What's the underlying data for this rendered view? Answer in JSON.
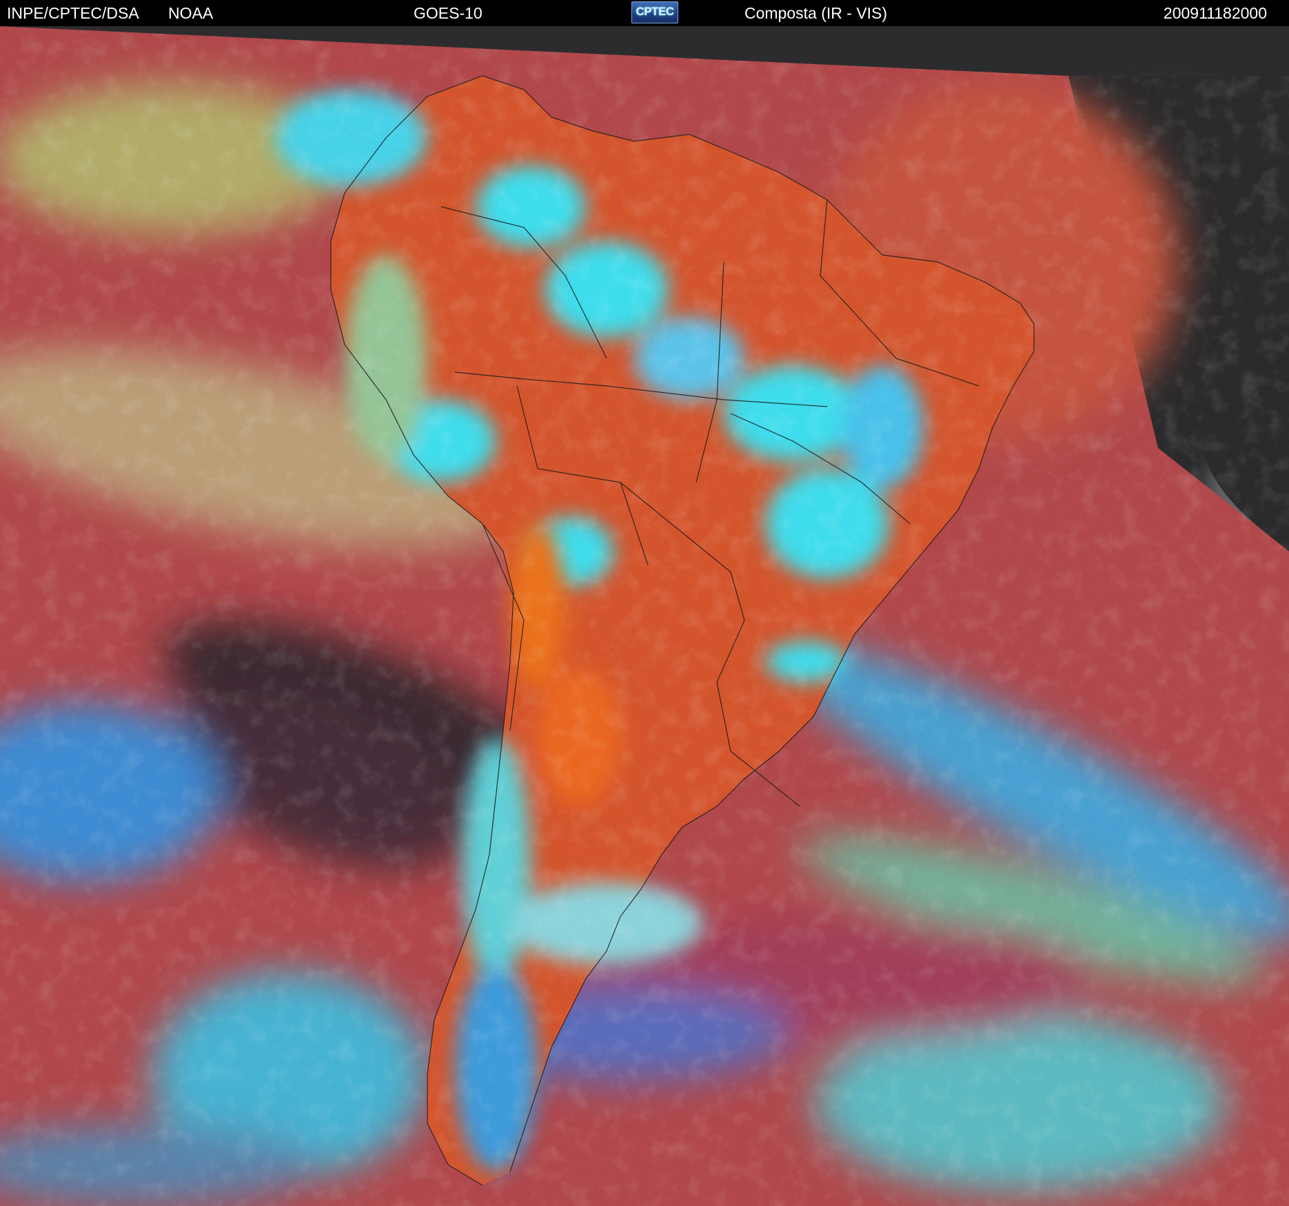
{
  "header": {
    "source": "INPE/CPTEC/DSA",
    "agency": "NOAA",
    "satellite": "GOES-10",
    "logo_text": "CPTEC",
    "product": "Composta (IR - VIS)",
    "timestamp": "200911182000"
  },
  "colors": {
    "background": "#000000",
    "header_text": "#ffffff",
    "clear_land": "#d9572e",
    "clear_ocean": "#b54a4d",
    "low_cloud": "#b9cf73",
    "high_cloud": "#3fe2f2",
    "mid_cloud": "#4aa8e8",
    "dry_air": "#3a2a30",
    "outside_disk": "#2c2c2e",
    "coastline": "#1a1a1a"
  },
  "icons": {
    "logo": "cptec-logo"
  }
}
